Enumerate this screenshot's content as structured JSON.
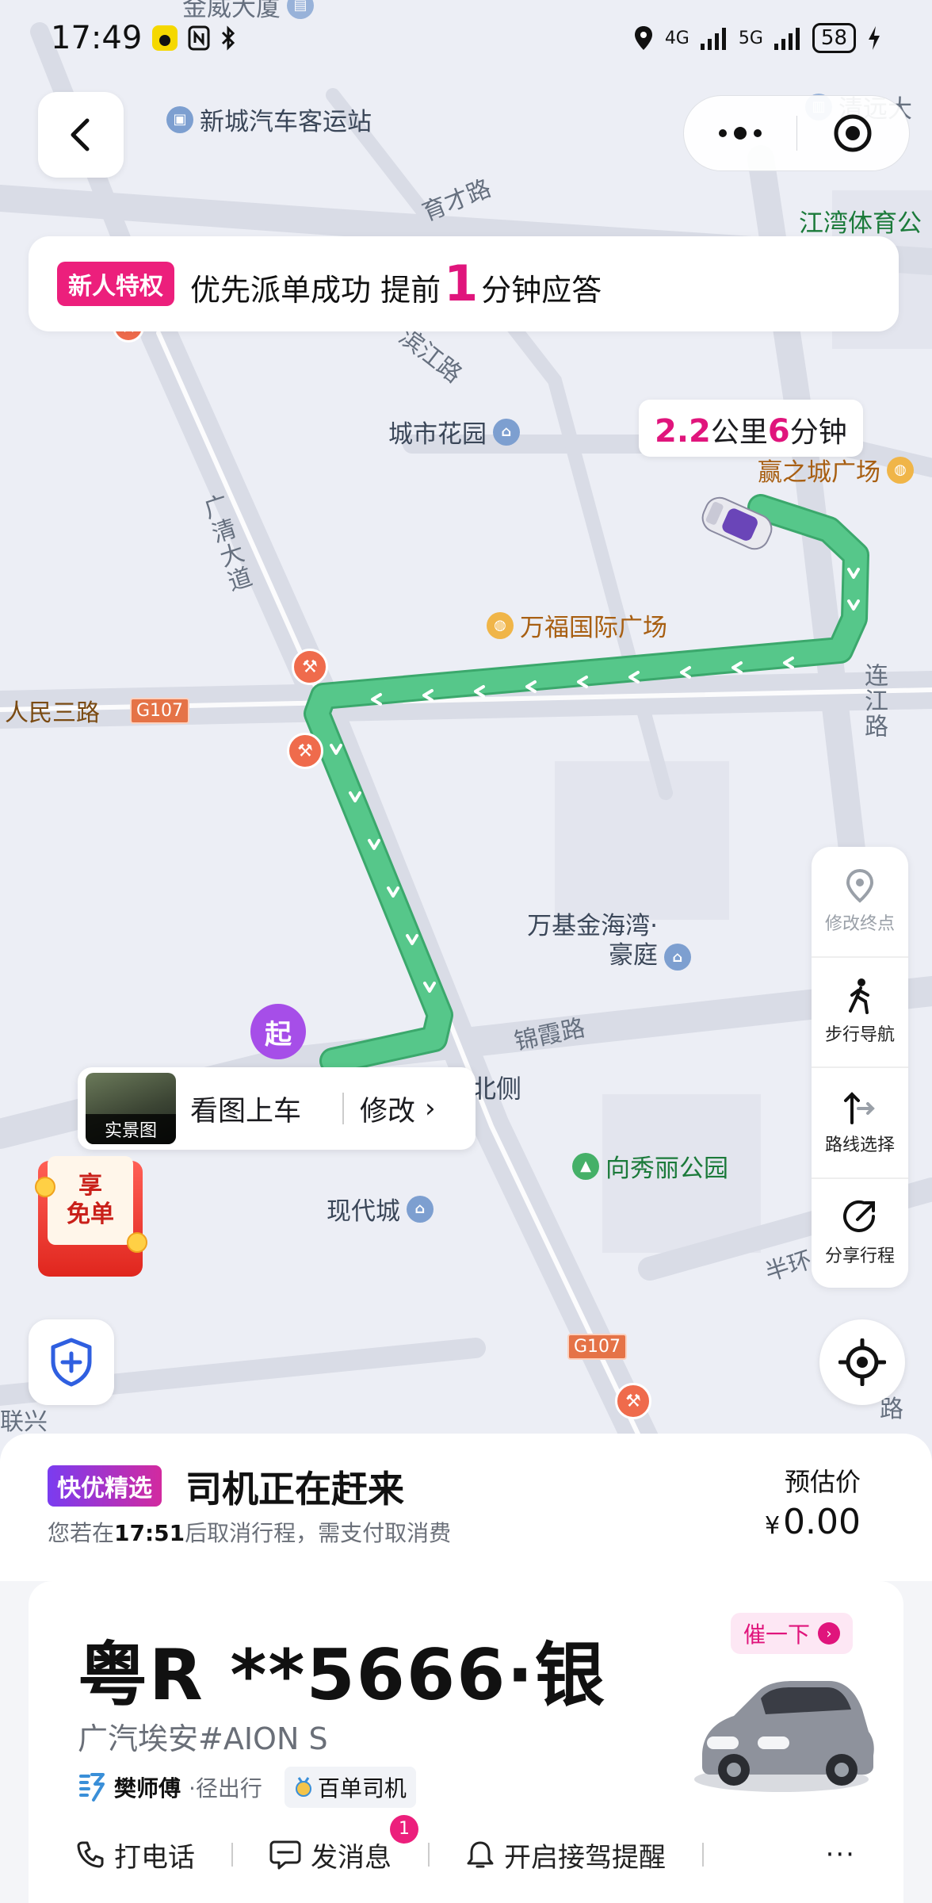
{
  "status_bar": {
    "time": "17:49",
    "network_1": "4G",
    "network_2": "5G",
    "battery": "58"
  },
  "map": {
    "pois": {
      "bus_station": "新城汽车客运站",
      "stadium": "江湾体育公",
      "qingyuan_top": "清远大",
      "top_left_partial": "金威大厦",
      "city_garden": "城市花园",
      "yingzhicheng": "赢之城广场",
      "wanfu": "万福国际广场",
      "wanji": "万基金海湾·豪庭",
      "xiangxiuli": "向秀丽公园",
      "xiandaicheng": "现代城",
      "side_partial": "北侧"
    },
    "roads": {
      "yucai": "育才路",
      "binjiang": "滨江路",
      "guangqing": "广清大道",
      "renmin3": "人民三路",
      "lianjiang": "连江路",
      "jinxia": "锦霞路",
      "banhuan": "半环",
      "lianxing": "联兴",
      "lu_partial": "路",
      "g107_a": "G107",
      "g107_b": "G107"
    }
  },
  "promo": {
    "tag": "新人特权",
    "text_before": "优先派单成功 提前",
    "highlight": "1",
    "text_after": "分钟应答"
  },
  "distance": {
    "km": "2.2",
    "km_unit": "公里",
    "min": "6",
    "min_unit": "分钟"
  },
  "start_marker": "起",
  "pickup": {
    "thumb_label": "实景图",
    "view_label": "看图上车",
    "modify_label": "修改"
  },
  "free_badge": {
    "line1": "享",
    "line2": "免单"
  },
  "tools": [
    {
      "label": "修改终点",
      "icon": "location-pin-icon"
    },
    {
      "label": "步行导航",
      "icon": "walk-icon"
    },
    {
      "label": "路线选择",
      "icon": "route-icon"
    },
    {
      "label": "分享行程",
      "icon": "share-icon"
    }
  ],
  "sheet": {
    "service_tag": "快优精选",
    "status": "司机正在赶来",
    "cancel_before": "您若在",
    "cancel_time": "17:51",
    "cancel_after": "后取消行程，需支付取消费",
    "est_label": "预估价",
    "currency": "¥",
    "est_price": "0.00"
  },
  "driver": {
    "plate": "粤R **5666·银",
    "model": "广汽埃安#AION S",
    "name": "樊师傅",
    "company": "·径出行",
    "credential": "百单司机",
    "urge": "催一下"
  },
  "actions": {
    "call": "打电话",
    "message": "发消息",
    "message_badge": "1",
    "reminder": "开启接驾提醒",
    "more": "···"
  },
  "colors": {
    "route": "#56c78a",
    "accent_pink": "#e0157c",
    "start_purple": "#a64ee8"
  }
}
